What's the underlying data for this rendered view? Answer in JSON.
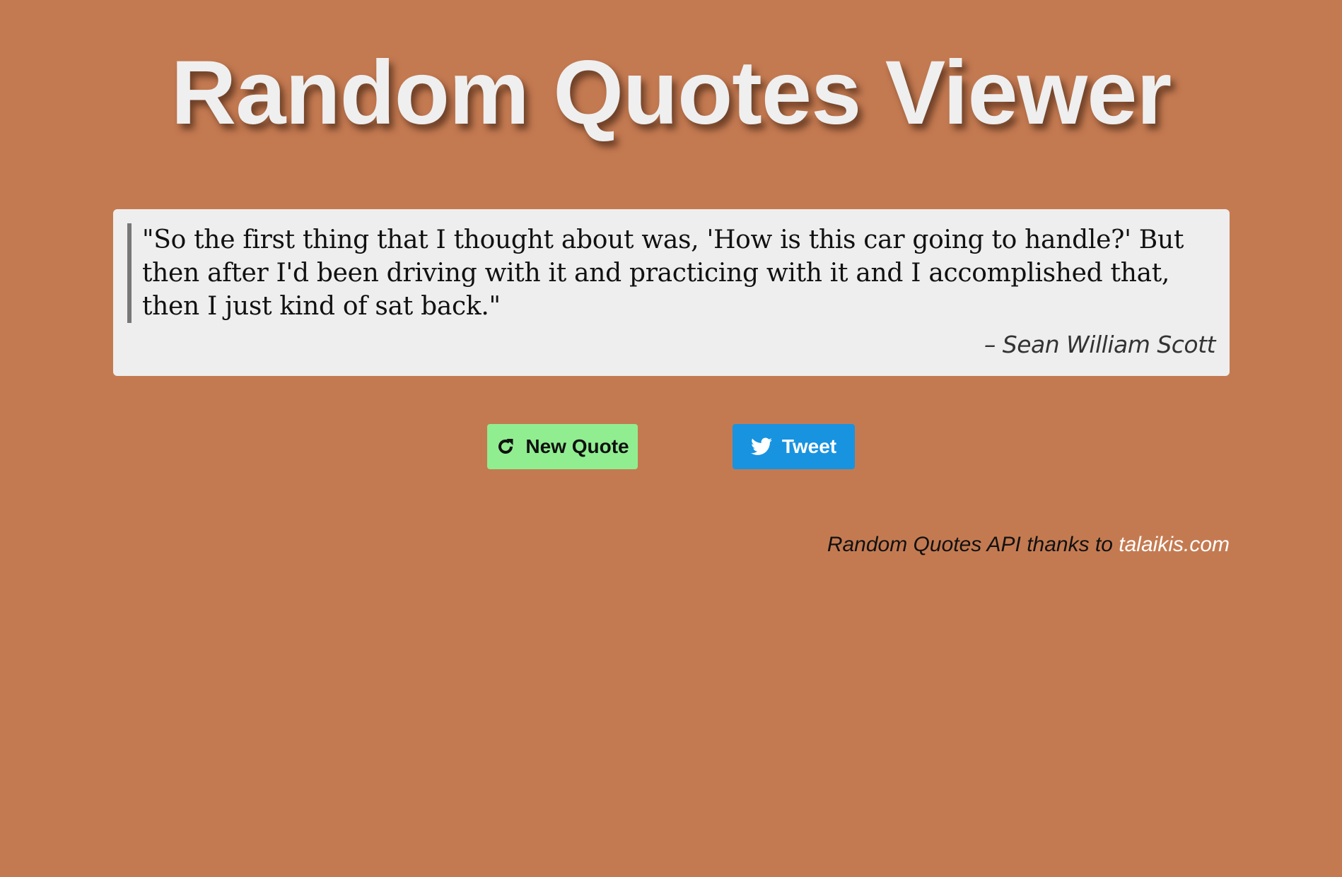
{
  "page": {
    "title": "Random Quotes Viewer",
    "background_color": "#c47a51"
  },
  "quote": {
    "text": "\"So the first thing that I thought about was, 'How is this car going to handle?' But then after I'd been driving with it and practicing with it and I accomplished that, then I just kind of sat back.\"",
    "author": "– Sean William Scott"
  },
  "buttons": {
    "new_quote": {
      "label": "New Quote",
      "icon": "refresh-icon",
      "color": "#90ee90"
    },
    "tweet": {
      "label": "Tweet",
      "icon": "twitter-icon",
      "color": "#1893e0"
    }
  },
  "footer": {
    "credit_prefix": "Random Quotes API thanks to ",
    "link_text": "talaikis.com"
  }
}
